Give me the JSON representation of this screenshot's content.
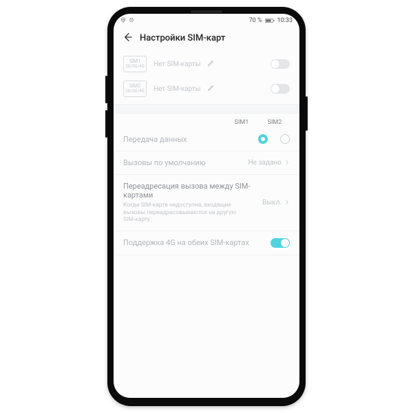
{
  "status": {
    "battery": "70 %",
    "time": "10:33"
  },
  "header": {
    "title": "Настройки SIM-карт"
  },
  "sim_slots": [
    {
      "chip_line1": "SIM1",
      "chip_line2": "2G/3G/4G",
      "label": "Нет SIM-карты"
    },
    {
      "chip_line1": "SIM2",
      "chip_line2": "2G/3G/4G",
      "label": "Нет SIM-карты"
    }
  ],
  "columns": {
    "c1": "SIM1",
    "c2": "SIM2"
  },
  "rows": {
    "data_transfer": {
      "label": "Передача данных"
    },
    "default_calls": {
      "label": "Вызовы по умолчанию",
      "value": "Не задано"
    },
    "call_forward": {
      "title": "Переадресация вызова между SIM-картами",
      "desc": "Когда SIM-карта недоступна, входящие вызовы переадресовываются на другую SIM-карту",
      "value": "Выкл."
    },
    "dual_4g": {
      "label": "Поддержка 4G на обеих SIM-картах"
    }
  }
}
